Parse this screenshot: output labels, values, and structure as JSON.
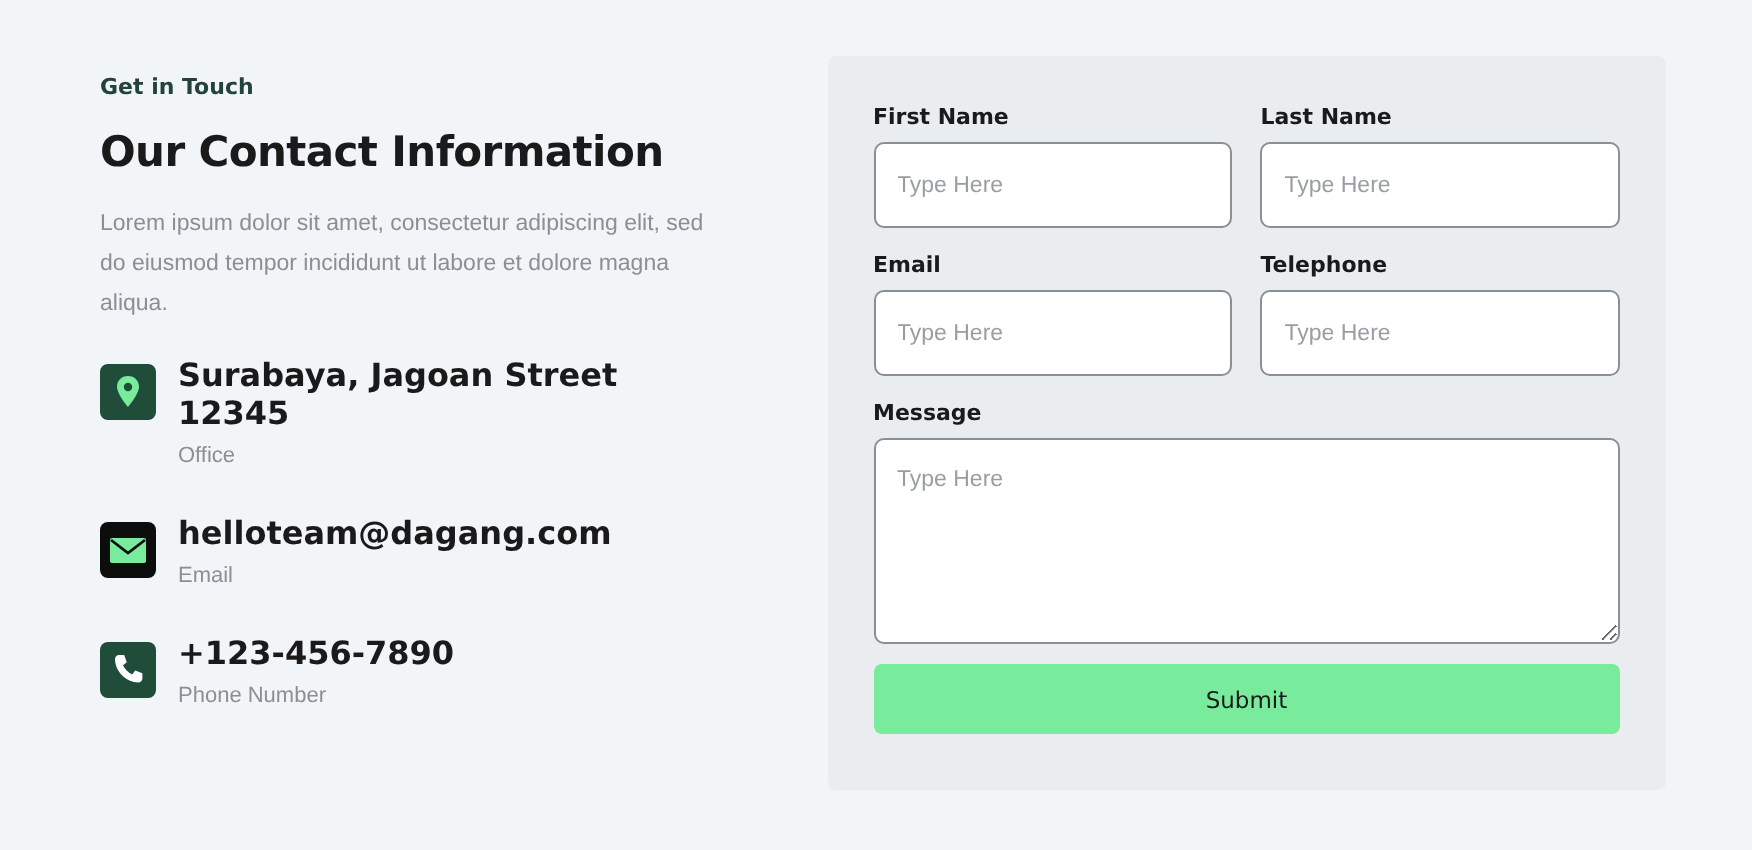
{
  "intro": {
    "eyebrow": "Get in Touch",
    "title": "Our Contact Information",
    "text": "Lorem ipsum dolor sit amet, consectetur adipiscing elit, sed do eiusmod tempor incididunt ut labore et dolore magna aliqua."
  },
  "contacts": [
    {
      "kind": "location",
      "color": "#1f4d3a",
      "value": "Surabaya, Jagoan Street 12345",
      "label": "Office"
    },
    {
      "kind": "email",
      "color": "#0d0d0d",
      "value": "helloteam@dagang.com",
      "label": "Email"
    },
    {
      "kind": "phone",
      "color": "#1f4d3a",
      "value": "+123-456-7890",
      "label": "Phone Number"
    }
  ],
  "form": {
    "fields": [
      {
        "kind": "input",
        "label": "First Name",
        "placeholder": "Type Here"
      },
      {
        "kind": "input",
        "label": "Last Name",
        "placeholder": "Type Here"
      },
      {
        "kind": "input",
        "label": "Email",
        "placeholder": "Type Here"
      },
      {
        "kind": "input",
        "label": "Telephone",
        "placeholder": "Type Here"
      },
      {
        "kind": "textarea",
        "label": "Message",
        "placeholder": "Type Here"
      }
    ],
    "submit": "Submit"
  }
}
